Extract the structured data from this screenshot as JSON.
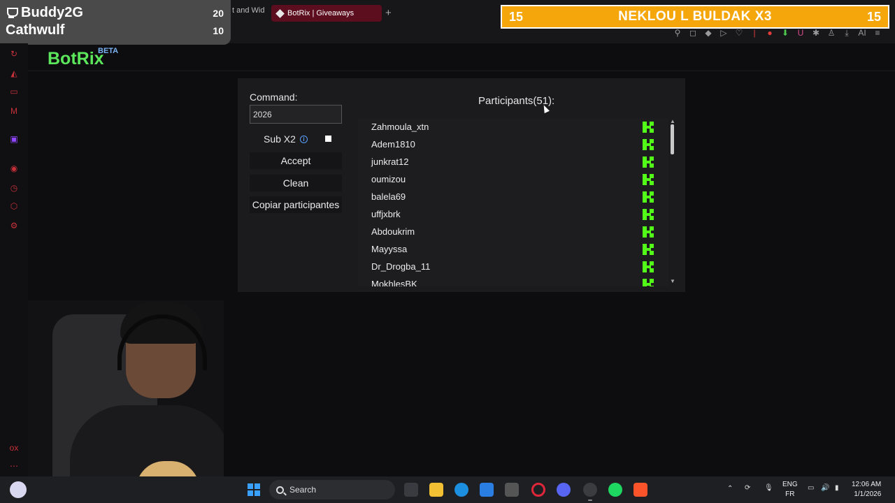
{
  "browser": {
    "partial_tab_label": "t and Wid",
    "active_tab_label": "BotRix | Giveaways",
    "new_tab_label": "+"
  },
  "leaderboard": {
    "entries": [
      {
        "name": "Buddy2G",
        "score": "20"
      },
      {
        "name": "Cathwulf",
        "score": "10"
      }
    ]
  },
  "banner": {
    "left_number": "15",
    "title": "NEKLOU L BULDAK X3",
    "right_number": "15",
    "color": "#f5a60a"
  },
  "app": {
    "logo": "BotRix",
    "logo_badge": "BETA",
    "brand_color": "#5ce65c"
  },
  "giveaway": {
    "command_label": "Command:",
    "command_value": "2026",
    "sub_x2_label": "Sub X2",
    "sub_x2_checked": false,
    "accept_label": "Accept",
    "clean_label": "Clean",
    "copy_label": "Copiar participantes",
    "participants_title": "Participants(51):",
    "participants": [
      "Zahmoula_xtn",
      "Adem1810",
      "junkrat12",
      "oumizou",
      "balela69",
      "uffjxbrk",
      "Abdoukrim",
      "Mayyssa",
      "Dr_Drogba_11",
      "MokhlesBK"
    ],
    "platform_icon": "kick-icon",
    "platform_color": "#53fc18"
  },
  "taskbar": {
    "search_label": "Search",
    "lang_top": "ENG",
    "lang_bottom": "FR",
    "time": "12:06 AM",
    "date": "1/1/2026"
  }
}
